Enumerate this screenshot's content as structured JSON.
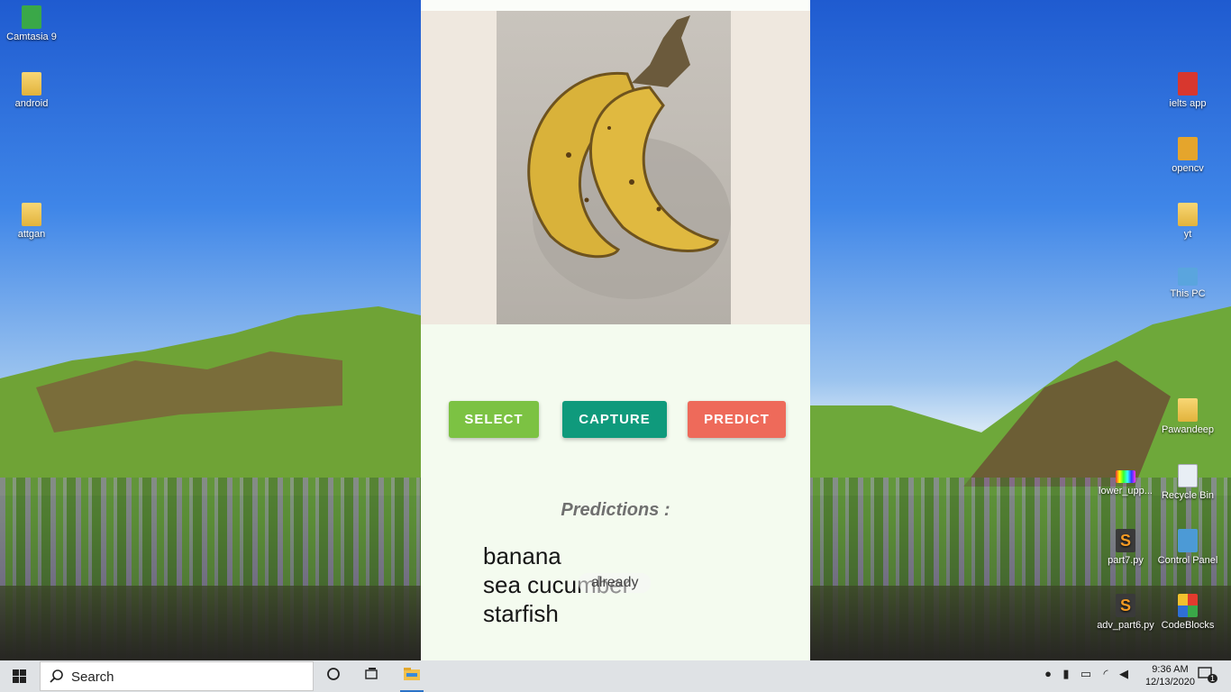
{
  "desktop": {
    "left_icons": [
      {
        "label": "Camtasia 9",
        "icon": "camtasia-icon"
      },
      {
        "label": "android",
        "icon": "file-icon"
      },
      {
        "label": "attgan",
        "icon": "file-icon"
      }
    ],
    "right_icons": [
      {
        "label": "ielts app",
        "icon": "file-icon"
      },
      {
        "label": "opencv",
        "icon": "file-icon"
      },
      {
        "label": "yt",
        "icon": "folder-icon"
      },
      {
        "label": "This PC",
        "icon": "computer-icon"
      },
      {
        "label": "Pawandeep",
        "icon": "user-folder-icon"
      },
      {
        "label": "lower_upp...",
        "icon": "image-icon"
      },
      {
        "label": "Recycle Bin",
        "icon": "recycle-bin-icon"
      },
      {
        "label": "part7.py",
        "icon": "sublime-icon"
      },
      {
        "label": "Control Panel",
        "icon": "control-panel-icon"
      },
      {
        "label": "adv_part6.py",
        "icon": "sublime-icon"
      },
      {
        "label": "CodeBlocks",
        "icon": "codeblocks-icon"
      }
    ]
  },
  "app": {
    "buttons": {
      "select": "SELECT",
      "capture": "CAPTURE",
      "predict": "PREDICT"
    },
    "predictions_title": "Predictions :",
    "predictions": [
      "banana",
      "sea cucumber",
      "starfish"
    ],
    "toast": "already",
    "colors": {
      "select": "#7cc243",
      "capture": "#0f9a7c",
      "predict": "#ee6a5a"
    }
  },
  "taskbar": {
    "search_placeholder": "Search",
    "time": "9:36 AM",
    "date": "12/13/2020",
    "notification_count": "1"
  }
}
